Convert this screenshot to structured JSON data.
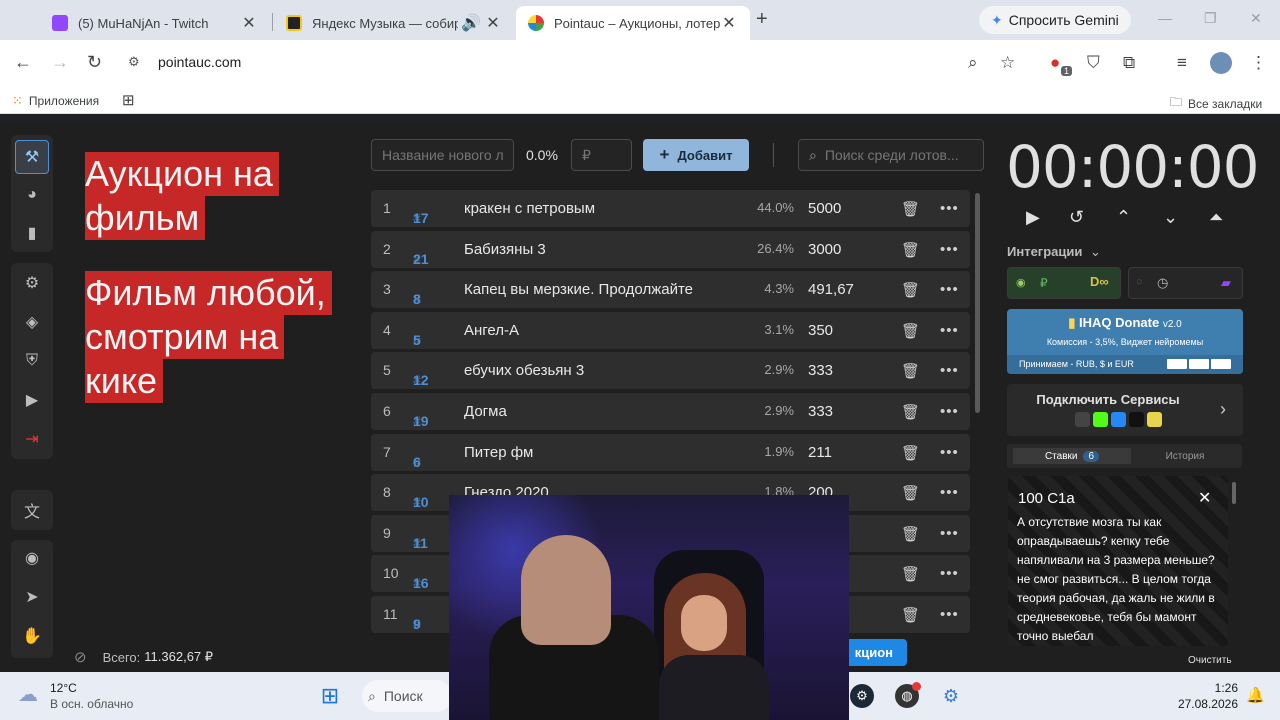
{
  "browser": {
    "tabs": [
      {
        "title": "(5) MuHaNjAn - Twitch",
        "close": "✕"
      },
      {
        "title": "Яндекс Музыка — собирае",
        "close": "✕"
      },
      {
        "title": "Pointauc – Аукционы, лотерей",
        "close": "✕"
      }
    ],
    "new_tab": "+",
    "gemini_label": "Спросить Gemini",
    "url": "pointauc.com",
    "extension_badge": "1",
    "bookmarks": {
      "apps": "Приложения",
      "all": "Все закладки"
    }
  },
  "auction": {
    "hero_lines": [
      "Аукцион на",
      "фильм",
      "Фильм любой,",
      "смотрим на",
      "кике"
    ],
    "name_placeholder": "Название нового л",
    "percent": "0.0%",
    "amount_placeholder": "₽",
    "add_label": "Добавит",
    "search_placeholder": "Поиск среди лотов...",
    "lots": [
      {
        "idx": "1",
        "id": "17",
        "name": "кракен с петровым",
        "pct": "44.0%",
        "amount": "5000"
      },
      {
        "idx": "2",
        "id": "21",
        "name": "Бабизяны 3",
        "pct": "26.4%",
        "amount": "3000"
      },
      {
        "idx": "3",
        "id": "8",
        "name": "Капец вы мерзкие. Продолжайте",
        "pct": "4.3%",
        "amount": "491,67"
      },
      {
        "idx": "4",
        "id": "5",
        "name": " Ангел-А",
        "pct": "3.1%",
        "amount": "350"
      },
      {
        "idx": "5",
        "id": "12",
        "name": "ебучих обезьян 3",
        "pct": "2.9%",
        "amount": "333"
      },
      {
        "idx": "6",
        "id": "19",
        "name": "Догма",
        "pct": "2.9%",
        "amount": "333"
      },
      {
        "idx": "7",
        "id": "6",
        "name": "Питер фм",
        "pct": "1.9%",
        "amount": "211"
      },
      {
        "idx": "8",
        "id": "10",
        "name": "Гнездо 2020",
        "pct": "1.8%",
        "amount": "200"
      },
      {
        "idx": "9",
        "id": "11",
        "name": "",
        "pct": "",
        "amount": ""
      },
      {
        "idx": "10",
        "id": "16",
        "name": "",
        "pct": "",
        "amount": ""
      },
      {
        "idx": "11",
        "id": "9",
        "name": "",
        "pct": "",
        "amount": ""
      }
    ],
    "total_label": "Всего:",
    "total_value": "11.362,67 ₽",
    "start_label": "кцион"
  },
  "right_panel": {
    "timer": "00:00:00",
    "integrations_label": "Интеграции",
    "donate_title": "IHAQ Donate",
    "donate_version": "v2.0",
    "donate_commission": "Комиссия - 3,5%, Виджет нейромемы",
    "donate_accepts": "Принимаем - RUB, $ и EUR",
    "services_label": "Подключить Сервисы",
    "tab_bids": "Ставки",
    "tab_bids_count": "6",
    "tab_history": "История",
    "bid_amount": "100 С1а",
    "bid_message": "А отсутствие мозга ты как оправдываешь? кепку тебе напяливали на 3 размера меньше? не смог развиться... В целом тогда теория рабочая, да жаль не жили в средневековье, тебя бы мамонт точно выебал",
    "clear_label": "Очистить"
  },
  "taskbar": {
    "weather_temp": "12°C",
    "weather_desc": "В осн. облачно",
    "search_label": "Поиск",
    "time": "1:26",
    "date": "27.08.2026"
  }
}
